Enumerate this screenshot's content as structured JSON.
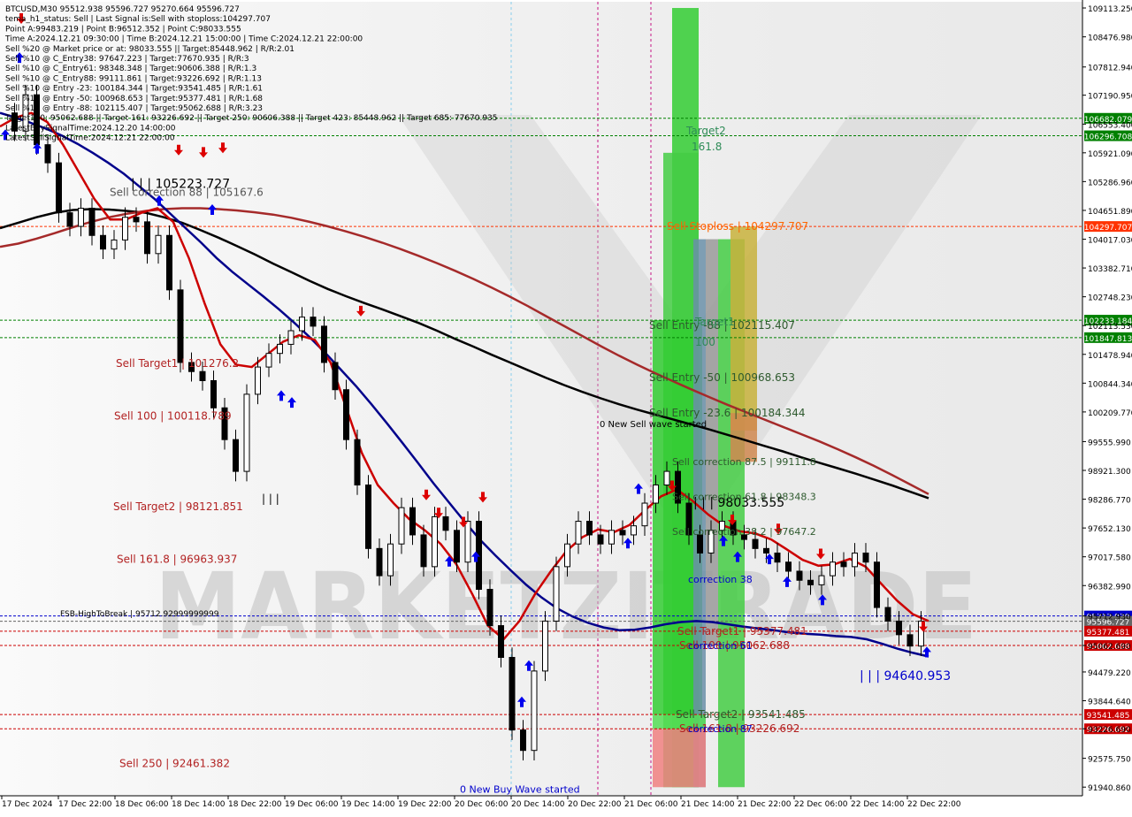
{
  "chart_data": {
    "type": "line",
    "symbol": "BTCUSD,M30",
    "ohlc_header": "95512.938 95596.727 95270.664 95596.727",
    "info_lines": [
      "BTCUSD,M30  95512.938 95596.727 95270.664 95596.727",
      "tema_h1_status: Sell | Last Signal is:Sell with stoploss:104297.707",
      "Point A:99483.219 | Point B:96512.352 | Point C:98033.555",
      "Time A:2024.12.21 09:30:00 | Time B:2024.12.21 15:00:00 | Time C:2024.12.21 22:00:00",
      "Sell %20 @ Market price or at: 98033.555 || Target:85448.962 | R/R:2.01",
      "Sell %10 @ C_Entry38: 97647.223 | Target:77670.935 | R/R:3",
      "Sell %10 @ C_Entry61: 98348.348 | Target:90606.388 | R/R:1.3",
      "Sell %10 @ C_Entry88: 99111.861 | Target:93226.692 | R/R:1.13",
      "Sell %10 @ Entry -23: 100184.344 | Target:93541.485 | R/R:1.61",
      "Sell %10 @ Entry -50: 100968.653 | Target:95377.481 | R/R:1.68",
      "Sell %10 @ Entry -88: 102115.407 | Target:95062.688 | R/R:3.23",
      "Target100: 95062.688 || Target 161: 93226.692 || Target 250: 90606.388 || Target 423: 85448.962 || Target 685: 77670.935",
      "LatestBuySignalTime:2024.12.20 14:00:00",
      "LatestSellSignalTime:2024.12.21 22:00:00"
    ],
    "y_ticks": [
      109113.25,
      108476.98,
      107812.94,
      107190.95,
      106553.4,
      105921.09,
      105286.96,
      104651.89,
      104017.03,
      103382.71,
      102748.23,
      102113.53,
      101478.94,
      100844.34,
      100209.77,
      99555.99,
      98921.3,
      98286.77,
      97652.13,
      97017.58,
      96382.99,
      95712.93,
      95062.69,
      94479.22,
      93844.64,
      93226.69,
      92575.75,
      91940.86
    ],
    "y_tick_labels": [
      "109113.250",
      "108476.980",
      "107812.940",
      "107190.950",
      "106553.400",
      "105921.090",
      "105286.960",
      "104651.890",
      "104017.030",
      "103382.710",
      "102748.230",
      "102113.530",
      "101478.940",
      "100844.340",
      "100209.770",
      "99555.990",
      "98921.300",
      "98286.770",
      "97652.130",
      "97017.580",
      "96382.990",
      "95712.930",
      "95062.690",
      "94479.220",
      "93844.640",
      "93226.690",
      "92575.750",
      "91940.860"
    ],
    "ylim": [
      91750,
      109250
    ],
    "x_labels": [
      "17 Dec 2024",
      "17 Dec 22:00",
      "18 Dec 06:00",
      "18 Dec 14:00",
      "18 Dec 22:00",
      "19 Dec 06:00",
      "19 Dec 14:00",
      "19 Dec 22:00",
      "20 Dec 06:00",
      "20 Dec 14:00",
      "20 Dec 22:00",
      "21 Dec 06:00",
      "21 Dec 14:00",
      "21 Dec 22:00",
      "22 Dec 06:00",
      "22 Dec 14:00",
      "22 Dec 22:00"
    ],
    "x_count": 84,
    "series": [
      {
        "color": "#000000",
        "values": [
          104260,
          104380,
          104500,
          104600,
          104660,
          104680,
          104670,
          104640,
          104600,
          104500,
          104380,
          104220,
          104050,
          103870,
          103680,
          103480,
          103290,
          103100,
          102920,
          102760,
          102610,
          102470,
          102320,
          102170,
          102000,
          101820,
          101650,
          101470,
          101300,
          101130,
          100960,
          100800,
          100650,
          100510,
          100380,
          100260,
          100150,
          100040,
          99930,
          99820,
          99700,
          99580,
          99460,
          99340,
          99210,
          99090,
          98970,
          98850,
          98720,
          98590,
          98450,
          98310
        ]
      },
      {
        "color": "#a52a2a",
        "values": [
          103850,
          103920,
          104030,
          104150,
          104280,
          104400,
          104500,
          104580,
          104640,
          104680,
          104700,
          104700,
          104680,
          104650,
          104610,
          104560,
          104490,
          104400,
          104300,
          104190,
          104070,
          103940,
          103800,
          103650,
          103490,
          103320,
          103140,
          102950,
          102750,
          102540,
          102320,
          102100,
          101880,
          101660,
          101450,
          101250,
          101060,
          100880,
          100700,
          100530,
          100360,
          100200,
          100040,
          99880,
          99720,
          99560,
          99390,
          99210,
          99020,
          98820,
          98610,
          98400
        ]
      },
      {
        "color": "#00008b",
        "values": [
          106800,
          106700,
          106580,
          106450,
          106300,
          106120,
          105920,
          105700,
          105460,
          105180,
          104900,
          104580,
          104260,
          103940,
          103600,
          103300,
          103030,
          102760,
          102480,
          102180,
          101860,
          101520,
          101150,
          100780,
          100380,
          99960,
          99530,
          99090,
          98640,
          98220,
          97800,
          97400,
          97050,
          96720,
          96400,
          96120,
          95880,
          95700,
          95560,
          95460,
          95400,
          95410,
          95460,
          95530,
          95580,
          95600,
          95580,
          95530,
          95480,
          95440,
          95400,
          95350,
          95320,
          95300,
          95270,
          95250,
          95200,
          95100,
          94990,
          94900,
          94820
        ]
      },
      {
        "color": "#cc0000",
        "values": [
          106500,
          106700,
          106800,
          106600,
          106100,
          105500,
          104900,
          104450,
          104450,
          104600,
          104700,
          104400,
          103600,
          102600,
          101700,
          101250,
          101200,
          101480,
          101760,
          101900,
          101800,
          101300,
          100300,
          99300,
          98600,
          98200,
          97850,
          97600,
          97300,
          96850,
          96200,
          95500,
          95200,
          95600,
          96200,
          96700,
          97150,
          97450,
          97620,
          97560,
          97720,
          98050,
          98350,
          98500,
          98250,
          97950,
          97700,
          97580,
          97530,
          97400,
          97180,
          96950,
          96820,
          96850,
          96970,
          96800,
          96420,
          96050,
          95750,
          95600
        ]
      }
    ],
    "candles_note": "candlestick price path",
    "price_path": [
      106800,
      106400,
      107200,
      106100,
      105700,
      104600,
      104300,
      104700,
      104100,
      103800,
      104000,
      104500,
      104400,
      103700,
      104100,
      102900,
      101300,
      101100,
      100900,
      100300,
      99600,
      98900,
      100600,
      101200,
      101500,
      101700,
      102000,
      102300,
      102100,
      101300,
      100700,
      99600,
      98600,
      97200,
      96600,
      97300,
      98100,
      97500,
      96800,
      97900,
      97600,
      96900,
      97800,
      96300,
      95500,
      94800,
      93200,
      92750,
      94500,
      95600,
      96800,
      97300,
      97800,
      97500,
      97300,
      97600,
      97500,
      97700,
      98200,
      98600,
      98900,
      98200,
      97500,
      97100,
      97600,
      97800,
      97500,
      97400,
      97200,
      97100,
      96900,
      96700,
      96500,
      96400,
      96600,
      96900,
      96800,
      97100,
      96900,
      95900,
      95600,
      95300,
      95050,
      95600
    ]
  },
  "levels": [
    {
      "name": "sell-stoploss-level",
      "price": 104297.707,
      "color": "#ff3300",
      "badge": "104297.707",
      "label": "Sell Stoploss | 104297.707"
    },
    {
      "name": "green-level-1",
      "price": 106682.079,
      "color": "#008000",
      "badge": "106682.079"
    },
    {
      "name": "green-level-2",
      "price": 106296.708,
      "color": "#008000",
      "badge": "106296.708"
    },
    {
      "name": "green-level-3",
      "price": 102233.184,
      "color": "#008000",
      "badge": "102233.184"
    },
    {
      "name": "green-level-4",
      "price": 101847.813,
      "color": "#008000",
      "badge": "101847.813"
    },
    {
      "name": "fsb-level",
      "price": 95712.93,
      "color": "#0000cc",
      "badge": "95712.930"
    },
    {
      "name": "current-price-level",
      "price": 95596.727,
      "color": "#666666",
      "badge": "95596.727"
    },
    {
      "name": "sell-target1-level",
      "price": 95377.481,
      "color": "#cc0000",
      "badge": "95377.481"
    },
    {
      "name": "sell-100-level",
      "price": 95062.688,
      "color": "#cc0000",
      "badge": "95062.688"
    },
    {
      "name": "sell-target2-level",
      "price": 93541.485,
      "color": "#cc0000",
      "badge": "93541.485"
    },
    {
      "name": "sell-161-level",
      "price": 93226.692,
      "color": "#cc0000",
      "badge": "93226.692"
    }
  ],
  "left_labels": [
    {
      "text": "| | | 105223.727",
      "price": 105223.727,
      "color": "#000000"
    },
    {
      "text": "Sell correction 88 | 105167.6",
      "price": 105050,
      "color": "#555555"
    },
    {
      "text": "Sell Target1 | 101276.2",
      "price": 101276.2,
      "color": "#b22222"
    },
    {
      "text": "Sell 100 | 100118.789",
      "price": 100118.789,
      "color": "#b22222"
    },
    {
      "text": "| | |",
      "price": 98300,
      "color": "#000000"
    },
    {
      "text": "Sell Target2 | 98121.851",
      "price": 98121.851,
      "color": "#b22222"
    },
    {
      "text": "Sell 161.8 | 96963.937",
      "price": 96963.937,
      "color": "#b22222"
    },
    {
      "text": "FSB-HighToBreak | 95712.92999999999",
      "price": 95780,
      "color": "#000000"
    },
    {
      "text": "Sell 250 | 92461.382",
      "price": 92461.382,
      "color": "#b22222"
    }
  ],
  "right_labels": [
    {
      "text": "Target2",
      "price": 106400,
      "color": "#2e8b57"
    },
    {
      "text": "161.8",
      "price": 106050,
      "color": "#2e8b57"
    },
    {
      "text": "Sell Stoploss | 104297.707",
      "price": 104297.707,
      "color": "#ff6600"
    },
    {
      "text": "Sell Entry -88 | 102115.407",
      "price": 102115.407,
      "color": "#2e5a2e"
    },
    {
      "text": "Target1",
      "price": 102200,
      "color": "#2e8b57"
    },
    {
      "text": "100",
      "price": 101750,
      "color": "#2e8b57"
    },
    {
      "text": "Sell Entry -50 | 100968.653",
      "price": 100968.653,
      "color": "#2e5a2e"
    },
    {
      "text": "Sell Entry -23.6 | 100184.344",
      "price": 100184.344,
      "color": "#2e5a2e"
    },
    {
      "text": "0 New Sell wave started",
      "price": 99950,
      "color": "#000000"
    },
    {
      "text": "Sell correction 87.5 | 99111.8",
      "price": 99111.8,
      "color": "#2e5a2e"
    },
    {
      "text": "| | | 98033.555",
      "price": 98200,
      "color": "#000000"
    },
    {
      "text": "Sell correction 61.8 | 98348.3",
      "price": 98348.3,
      "color": "#2e5a2e"
    },
    {
      "text": "Sell correction 38.2 | 97647.2",
      "price": 97580,
      "color": "#2e5a2e"
    },
    {
      "text": "correction 38",
      "price": 96520,
      "color": "#0000cc"
    },
    {
      "text": "Sell Target1 | 95377.481",
      "price": 95377.481,
      "color": "#b22222"
    },
    {
      "text": "Sell 100 | 95062.688",
      "price": 95062.688,
      "color": "#b22222"
    },
    {
      "text": "correction 61",
      "price": 95062.688,
      "color": "#0000cc"
    },
    {
      "text": "| | | 94640.953",
      "price": 94380,
      "color": "#0000cc"
    },
    {
      "text": "Sell Target2 | 93541.485",
      "price": 93541.485,
      "color": "#2e5a2e"
    },
    {
      "text": "Sell 161.8 | 93226.692",
      "price": 93226.692,
      "color": "#b22222"
    },
    {
      "text": "correction 87",
      "price": 93226.692,
      "color": "#0000cc"
    },
    {
      "text": "0 New Buy Wave started",
      "price": 91900,
      "color": "#0000cc"
    }
  ],
  "watermark": "MARKETZITRADE"
}
